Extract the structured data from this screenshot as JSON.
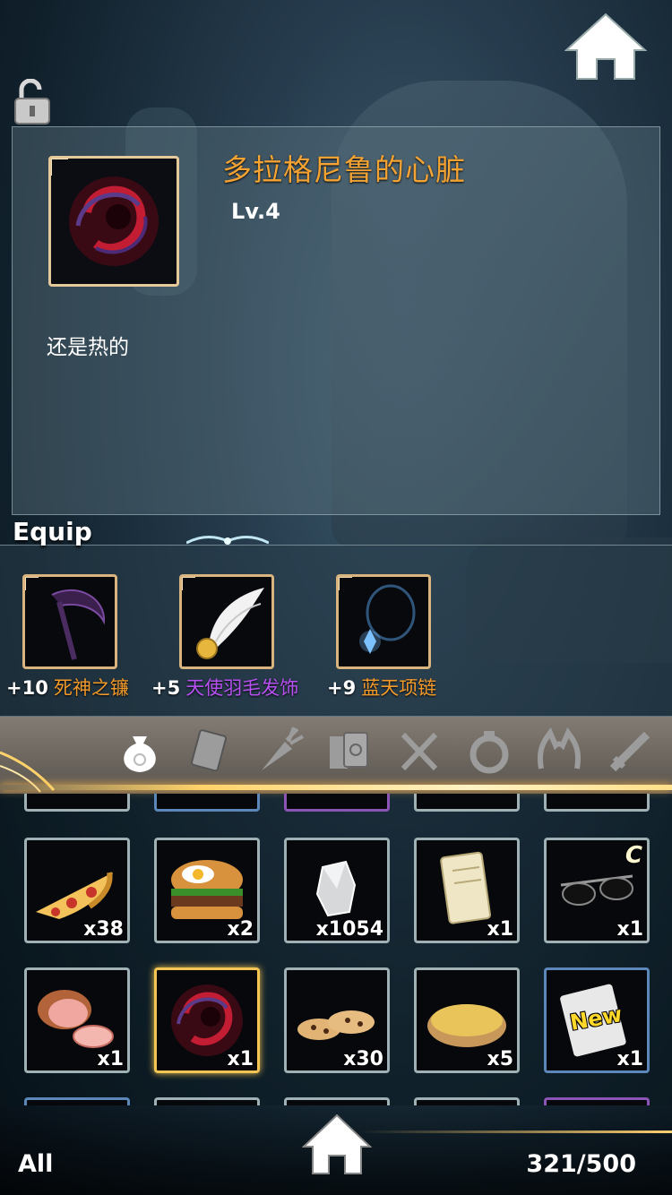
{
  "detail": {
    "name": "多拉格尼鲁的心脏",
    "level": "Lv.4",
    "description": "还是热的",
    "icon": "dark-heart-icon"
  },
  "equip": {
    "label": "Equip",
    "items": [
      {
        "plus": "+10",
        "name": "死神之镰",
        "color": "#f39a2a",
        "icon": "scythe-icon"
      },
      {
        "plus": "+5",
        "name": "天使羽毛发饰",
        "color": "#b650f0",
        "icon": "wing-hairpin-icon"
      },
      {
        "plus": "+9",
        "name": "蓝天项链",
        "color": "#f39a2a",
        "icon": "blue-necklace-icon"
      }
    ]
  },
  "tabs": [
    {
      "name": "bag",
      "icon": "bag-icon",
      "active": true
    },
    {
      "name": "card",
      "icon": "card-icon"
    },
    {
      "name": "material",
      "icon": "carrot-icon"
    },
    {
      "name": "book",
      "icon": "book-icon"
    },
    {
      "name": "food",
      "icon": "fork-knife-icon"
    },
    {
      "name": "ring",
      "icon": "ring-icon"
    },
    {
      "name": "headgear",
      "icon": "cat-ears-icon"
    },
    {
      "name": "weapon",
      "icon": "sword-icon"
    }
  ],
  "inventory": {
    "row1": [
      {
        "icon": "pizza-icon",
        "qty": "x38"
      },
      {
        "icon": "burger-icon",
        "qty": "x2"
      },
      {
        "icon": "crystal-icon",
        "qty": "x1054"
      },
      {
        "icon": "scroll-icon",
        "qty": "x1"
      },
      {
        "icon": "sunglasses-icon",
        "qty": "x1",
        "badge": "C"
      }
    ],
    "row2": [
      {
        "icon": "ham-icon",
        "qty": "x1"
      },
      {
        "icon": "dark-heart-icon",
        "qty": "x1",
        "selected": true
      },
      {
        "icon": "cookie-icon",
        "qty": "x30"
      },
      {
        "icon": "soup-icon",
        "qty": "x5"
      },
      {
        "icon": "paper-icon",
        "qty": "x1",
        "badge": "New"
      }
    ]
  },
  "footer": {
    "filter": "All",
    "capacity": "321/500"
  }
}
